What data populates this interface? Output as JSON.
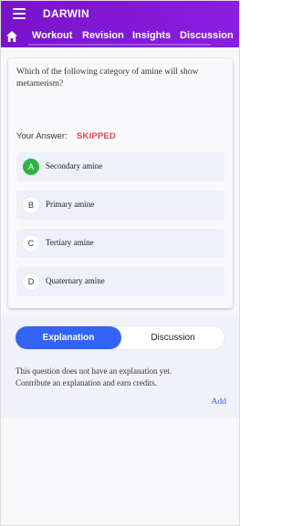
{
  "app": {
    "title": "DARWIN"
  },
  "nav": {
    "tabs": [
      "Workout",
      "Revision",
      "Insights",
      "Discussion"
    ]
  },
  "question": {
    "text": "Which of the following category of amine will show metamerism?",
    "answer_label": "Your Answer:",
    "answer_status": "SKIPPED",
    "options": [
      {
        "letter": "A",
        "text": "Secondary amine",
        "correct": true
      },
      {
        "letter": "B",
        "text": "Primary amine",
        "correct": false
      },
      {
        "letter": "C",
        "text": "Tertiary amine",
        "correct": false
      },
      {
        "letter": "D",
        "text": "Quaternary amine",
        "correct": false
      }
    ]
  },
  "panel": {
    "tabs": {
      "active": "Explanation",
      "inactive": "Discussion"
    },
    "message_line1": "This question does not have an explanation yet.",
    "message_line2": "Contribute an explanation and earn credits.",
    "add_label": "Add"
  },
  "colors": {
    "appbar": "#7a12cc",
    "accent": "#3364f5",
    "correct": "#2fb344",
    "skipped": "#e04848",
    "link": "#3a5be0"
  }
}
